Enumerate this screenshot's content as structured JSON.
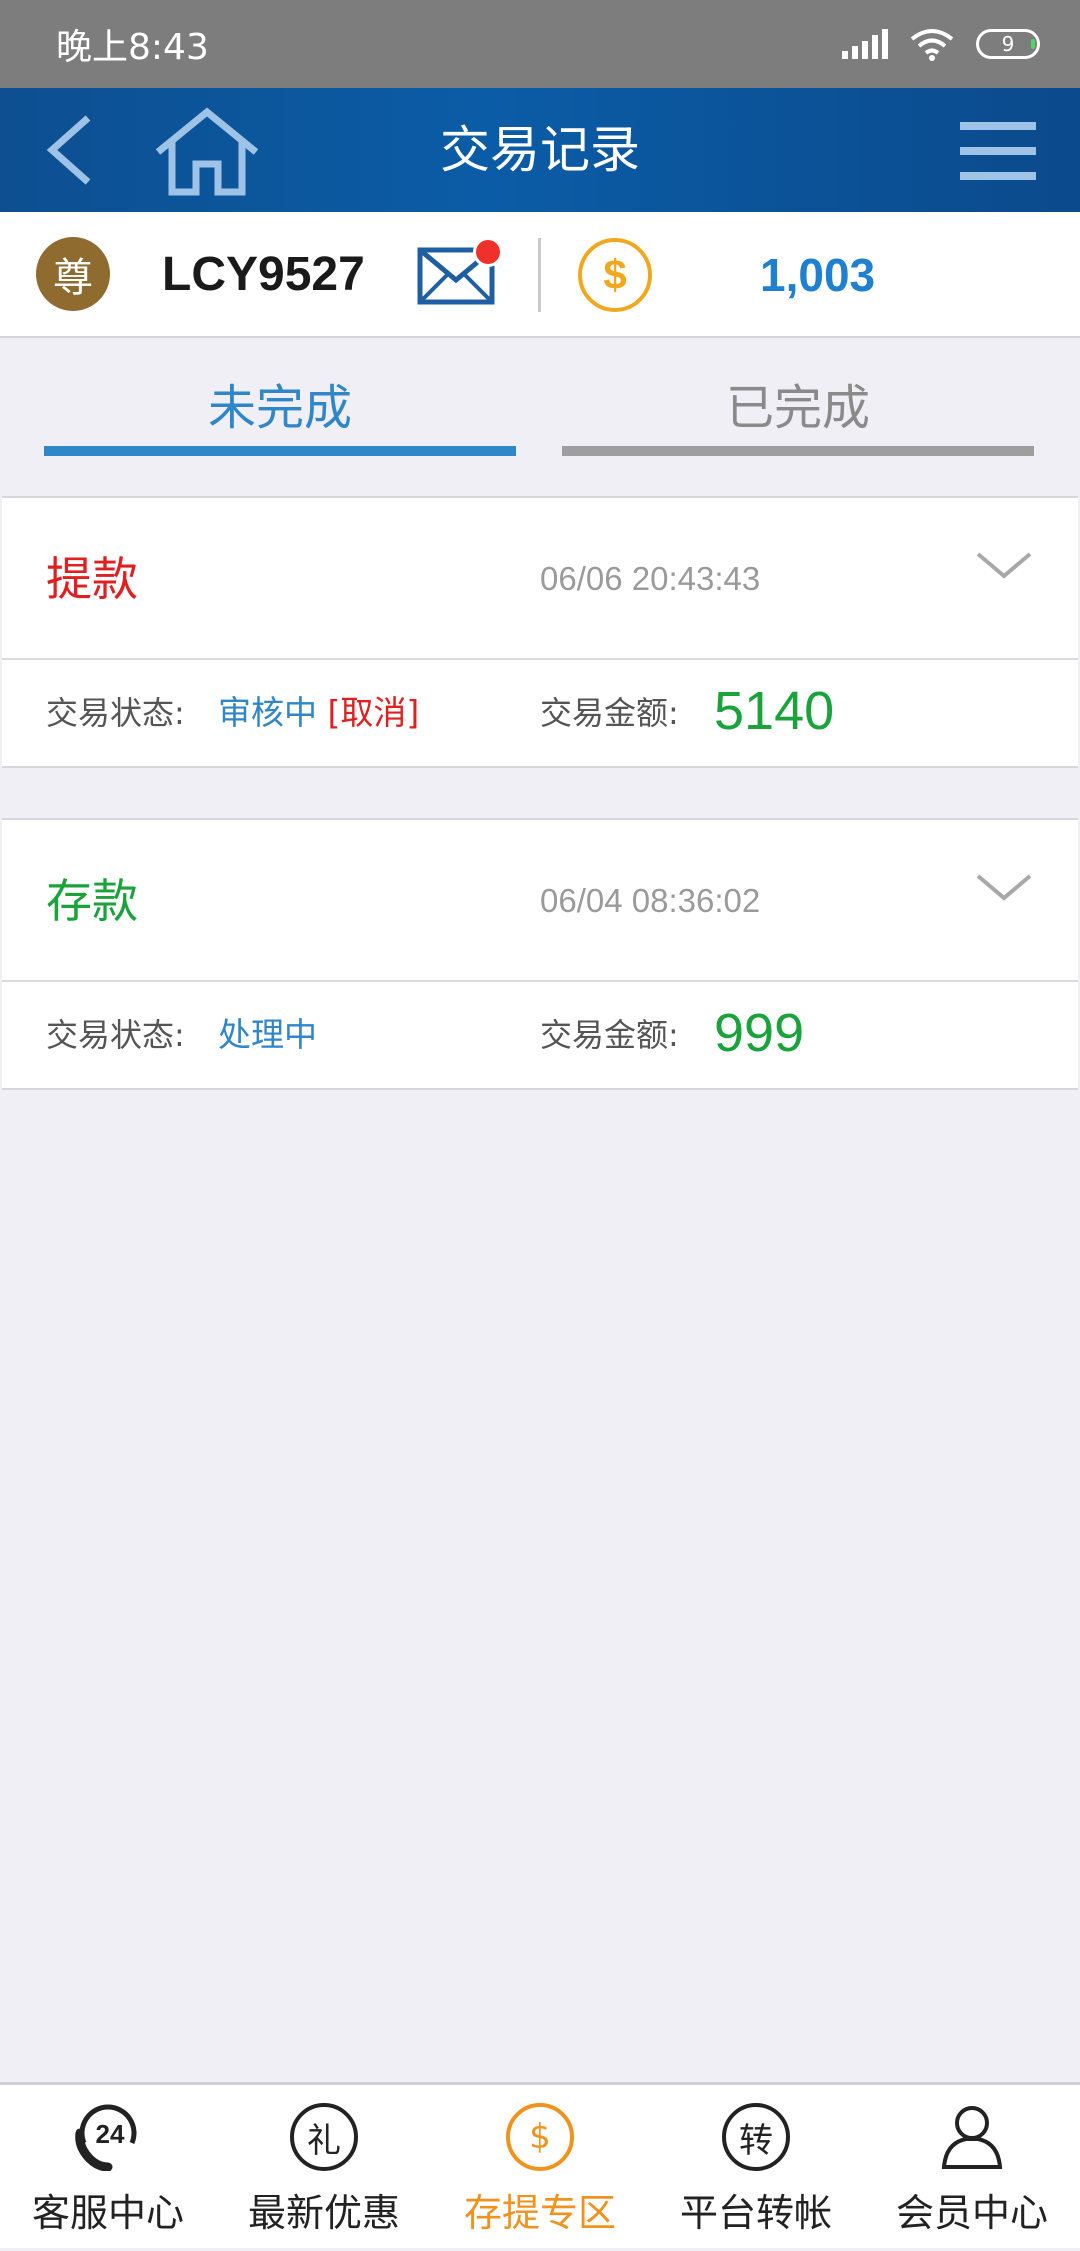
{
  "status_bar": {
    "time": "晚上8:43",
    "battery": "9"
  },
  "header": {
    "title": "交易记录",
    "icons": [
      "back-icon",
      "home-icon",
      "menu-icon"
    ]
  },
  "account": {
    "vip_badge": "尊",
    "username": "LCY9527",
    "balance": "1,003",
    "coin_symbol": "$",
    "has_unread_mail": true
  },
  "tabs": [
    {
      "label": "未完成",
      "active": true
    },
    {
      "label": "已完成",
      "active": false
    }
  ],
  "records": [
    {
      "type": "提款",
      "type_color": "#e02020",
      "datetime": "06/06 20:43:43",
      "status_label": "交易状态:",
      "status": "审核中",
      "cancel_label": "[取消]",
      "amount_label": "交易金额:",
      "amount": "5140"
    },
    {
      "type": "存款",
      "type_color": "#1aa33b",
      "datetime": "06/04 08:36:02",
      "status_label": "交易状态:",
      "status": "处理中",
      "amount_label": "交易金额:",
      "amount": "999"
    }
  ],
  "bottom_nav": [
    {
      "label": "客服中心",
      "icon": "support-24-icon",
      "glyph": "24",
      "active": false
    },
    {
      "label": "最新优惠",
      "icon": "gift-icon",
      "glyph": "礼",
      "active": false
    },
    {
      "label": "存提专区",
      "icon": "dollar-icon",
      "glyph": "$",
      "active": true
    },
    {
      "label": "平台转帐",
      "icon": "transfer-icon",
      "glyph": "转",
      "active": false
    },
    {
      "label": "会员中心",
      "icon": "member-icon",
      "glyph": "",
      "active": false
    }
  ],
  "colors": {
    "header_blue": "#0b5ca6",
    "accent_blue": "#2f86c8",
    "active_orange": "#f0921e",
    "withdraw_red": "#e02020",
    "deposit_green": "#1aa33b"
  }
}
